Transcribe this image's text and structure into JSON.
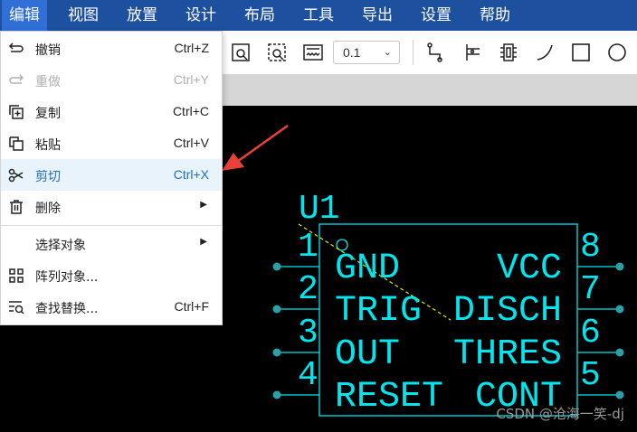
{
  "menubar": {
    "items": [
      "编辑",
      "视图",
      "放置",
      "设计",
      "布局",
      "工具",
      "导出",
      "设置",
      "帮助"
    ]
  },
  "toolbar": {
    "grid_value": "0.1"
  },
  "edit_menu": {
    "items": [
      {
        "label": "撤销",
        "shortcut": "Ctrl+Z",
        "icon": "undo-icon"
      },
      {
        "label": "重做",
        "shortcut": "Ctrl+Y",
        "icon": "redo-icon"
      },
      {
        "label": "复制",
        "shortcut": "Ctrl+C",
        "icon": "copy-icon"
      },
      {
        "label": "粘贴",
        "shortcut": "Ctrl+V",
        "icon": "paste-icon"
      },
      {
        "label": "剪切",
        "shortcut": "Ctrl+X",
        "icon": "scissors-icon"
      },
      {
        "label": "删除",
        "shortcut": "",
        "icon": "trash-icon"
      },
      {
        "label": "选择对象",
        "shortcut": "",
        "icon": ""
      },
      {
        "label": "阵列对象...",
        "shortcut": "",
        "icon": "grid-icon"
      },
      {
        "label": "查找替换...",
        "shortcut": "Ctrl+F",
        "icon": "find-replace-icon"
      }
    ]
  },
  "schematic": {
    "ref": "U1",
    "pins_left": [
      {
        "num": "1",
        "name": "GND"
      },
      {
        "num": "2",
        "name": "TRIG"
      },
      {
        "num": "3",
        "name": "OUT"
      },
      {
        "num": "4",
        "name": "RESET"
      }
    ],
    "pins_right": [
      {
        "num": "8",
        "name": "VCC"
      },
      {
        "num": "7",
        "name": "DISCH"
      },
      {
        "num": "6",
        "name": "THRES"
      },
      {
        "num": "5",
        "name": "CONT"
      }
    ],
    "color": "#00e5ee"
  },
  "watermark": "CSDN @沧海一笑-dj"
}
